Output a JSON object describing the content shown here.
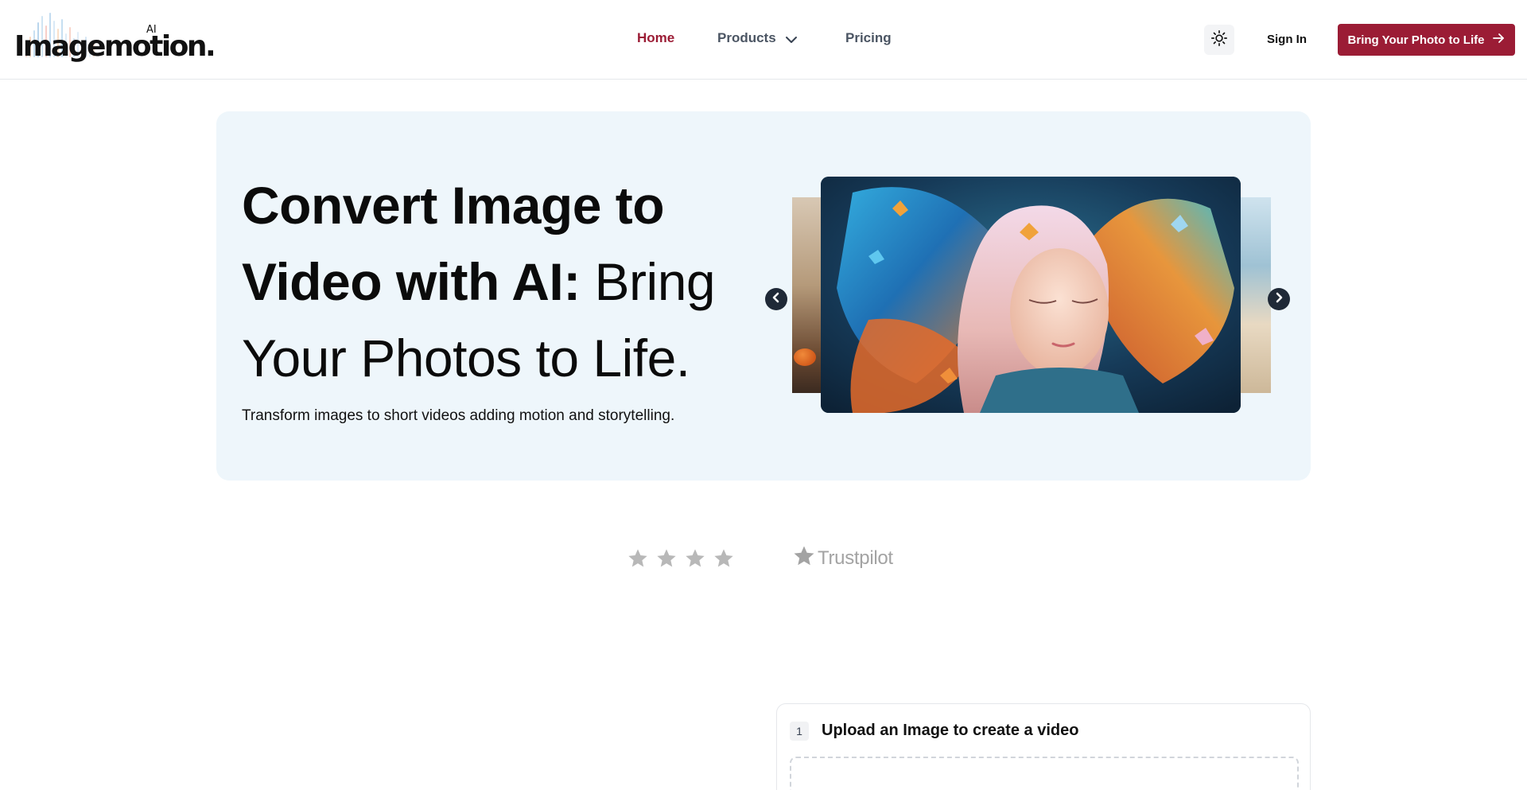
{
  "brand": {
    "name": "Imagemotion.",
    "badge": "AI"
  },
  "nav": {
    "home": "Home",
    "products": "Products",
    "pricing": "Pricing",
    "active": "Home"
  },
  "header": {
    "theme_icon": "sun-icon",
    "sign_in": "Sign In",
    "cta": "Bring Your Photo to Life",
    "accent_color": "#9b1c35"
  },
  "hero": {
    "title_bold": "Convert Image to Video with AI:",
    "title_light": "Bring Your Photos to Life.",
    "subtitle": "Transform images to short videos adding motion and storytelling.",
    "background": "#eef6fb"
  },
  "carousel": {
    "prev_icon": "chevron-left-icon",
    "next_icon": "chevron-right-icon"
  },
  "rating": {
    "stars_shown": 4,
    "provider": "Trustpilot"
  },
  "upload": {
    "step": "1",
    "title": "Upload an Image to create a video"
  }
}
